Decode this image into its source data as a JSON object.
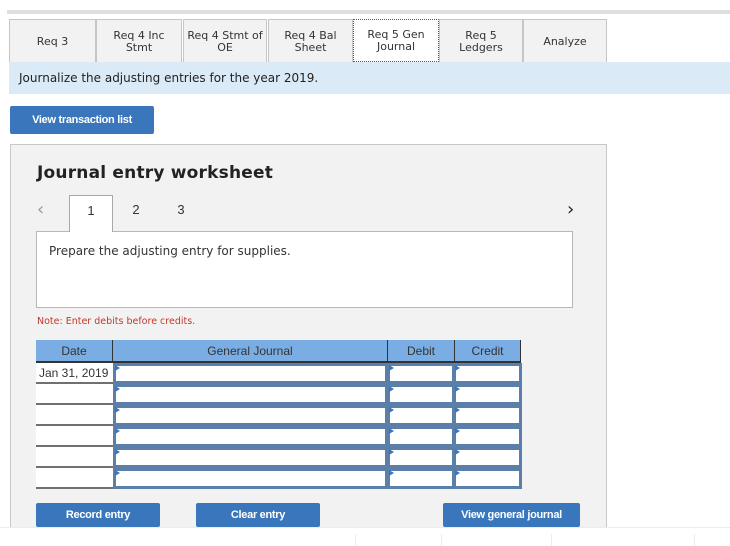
{
  "tabs": [
    {
      "label": "Req 3",
      "active": false
    },
    {
      "label": "Req 4 Inc Stmt",
      "active": false
    },
    {
      "label": "Req 4 Stmt of OE",
      "active": false
    },
    {
      "label": "Req 4 Bal Sheet",
      "active": false
    },
    {
      "label": "Req 5 Gen Journal",
      "active": true
    },
    {
      "label": "Req 5 Ledgers",
      "active": false
    },
    {
      "label": "Analyze",
      "active": false
    }
  ],
  "instruction": "Journalize the adjusting entries for the year 2019.",
  "buttons": {
    "view_transaction_list": "View transaction list",
    "record_entry": "Record entry",
    "clear_entry": "Clear entry",
    "view_general_journal": "View general journal"
  },
  "worksheet": {
    "title": "Journal entry worksheet",
    "pages": [
      "1",
      "2",
      "3"
    ],
    "current_page": "1",
    "prev_icon": "chevron-left-icon",
    "next_icon": "chevron-right-icon",
    "prompt": "Prepare the adjusting entry for supplies.",
    "note": "Note: Enter debits before credits."
  },
  "journal": {
    "headers": {
      "date": "Date",
      "general_journal": "General Journal",
      "debit": "Debit",
      "credit": "Credit"
    },
    "rows": [
      {
        "date": "Jan 31, 2019",
        "account": "",
        "debit": "",
        "credit": ""
      },
      {
        "date": "",
        "account": "",
        "debit": "",
        "credit": ""
      },
      {
        "date": "",
        "account": "",
        "debit": "",
        "credit": ""
      },
      {
        "date": "",
        "account": "",
        "debit": "",
        "credit": ""
      },
      {
        "date": "",
        "account": "",
        "debit": "",
        "credit": ""
      },
      {
        "date": "",
        "account": "",
        "debit": "",
        "credit": ""
      }
    ]
  },
  "colors": {
    "accent": "#3a76bb",
    "header_blue": "#79ade3",
    "instruction_bg": "#dbeaf7",
    "note_red": "#c0392b"
  }
}
